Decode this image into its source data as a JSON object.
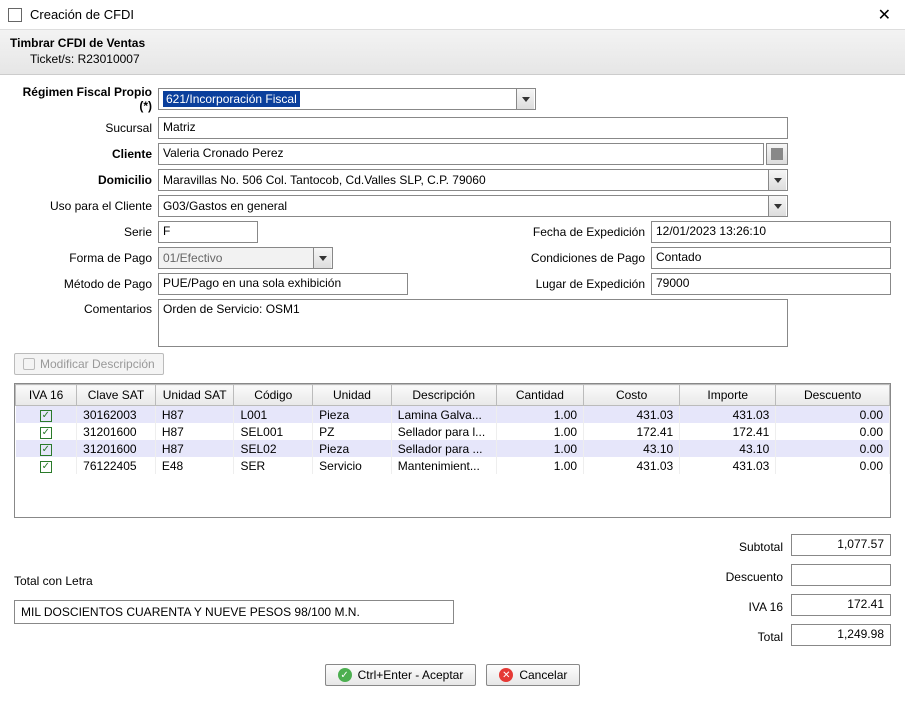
{
  "window": {
    "title": "Creación de CFDI",
    "subtitle": "Timbrar CFDI de Ventas",
    "ticket_label": "Ticket/s:",
    "ticket_value": "R23010007"
  },
  "labels": {
    "regimen": "Régimen Fiscal Propio (*)",
    "sucursal": "Sucursal",
    "cliente": "Cliente",
    "domicilio": "Domicilio",
    "uso": "Uso para el Cliente",
    "serie": "Serie",
    "fecha_exp": "Fecha de Expedición",
    "forma_pago": "Forma de Pago",
    "cond_pago": "Condiciones de Pago",
    "metodo_pago": "Método de Pago",
    "lugar_exp": "Lugar de Expedición",
    "comentarios": "Comentarios",
    "mod_desc": "Modificar Descripción",
    "subtotal": "Subtotal",
    "descuento": "Descuento",
    "iva": "IVA 16",
    "total": "Total",
    "total_letra": "Total con Letra"
  },
  "values": {
    "regimen": "621/Incorporación Fiscal",
    "sucursal": "Matriz",
    "cliente": "Valeria Cronado Perez",
    "domicilio": "Maravillas No. 506 Col. Tantocob, Cd.Valles SLP, C.P. 79060",
    "uso": "G03/Gastos en general",
    "serie": "F",
    "fecha_exp": "12/01/2023 13:26:10",
    "forma_pago": "01/Efectivo",
    "cond_pago": "Contado",
    "metodo_pago": "PUE/Pago en una sola exhibición",
    "lugar_exp": "79000",
    "comentarios": "Orden de Servicio: OSM1",
    "subtotal": "1,077.57",
    "descuento_total": "",
    "iva_total": "172.41",
    "total": "1,249.98",
    "total_letra": "MIL DOSCIENTOS CUARENTA Y NUEVE PESOS 98/100 M.N."
  },
  "grid": {
    "headers": [
      "IVA 16",
      "Clave SAT",
      "Unidad SAT",
      "Código",
      "Unidad",
      "Descripción",
      "Cantidad",
      "Costo",
      "Importe",
      "Descuento"
    ],
    "rows": [
      {
        "checked": true,
        "clave": "30162003",
        "usat": "H87",
        "codigo": "L001",
        "unidad": "Pieza",
        "desc": "Lamina Galva...",
        "cant": "1.00",
        "costo": "431.03",
        "importe": "431.03",
        "dto": "0.00"
      },
      {
        "checked": true,
        "clave": "31201600",
        "usat": "H87",
        "codigo": "SEL001",
        "unidad": "PZ",
        "desc": "Sellador para l...",
        "cant": "1.00",
        "costo": "172.41",
        "importe": "172.41",
        "dto": "0.00"
      },
      {
        "checked": true,
        "clave": "31201600",
        "usat": "H87",
        "codigo": "SEL02",
        "unidad": "Pieza",
        "desc": "Sellador para ...",
        "cant": "1.00",
        "costo": "43.10",
        "importe": "43.10",
        "dto": "0.00"
      },
      {
        "checked": true,
        "clave": "76122405",
        "usat": "E48",
        "codigo": "SER",
        "unidad": "Servicio",
        "desc": "Mantenimient...",
        "cant": "1.00",
        "costo": "431.03",
        "importe": "431.03",
        "dto": "0.00"
      }
    ]
  },
  "buttons": {
    "accept": "Ctrl+Enter - Aceptar",
    "cancel": "Cancelar"
  }
}
